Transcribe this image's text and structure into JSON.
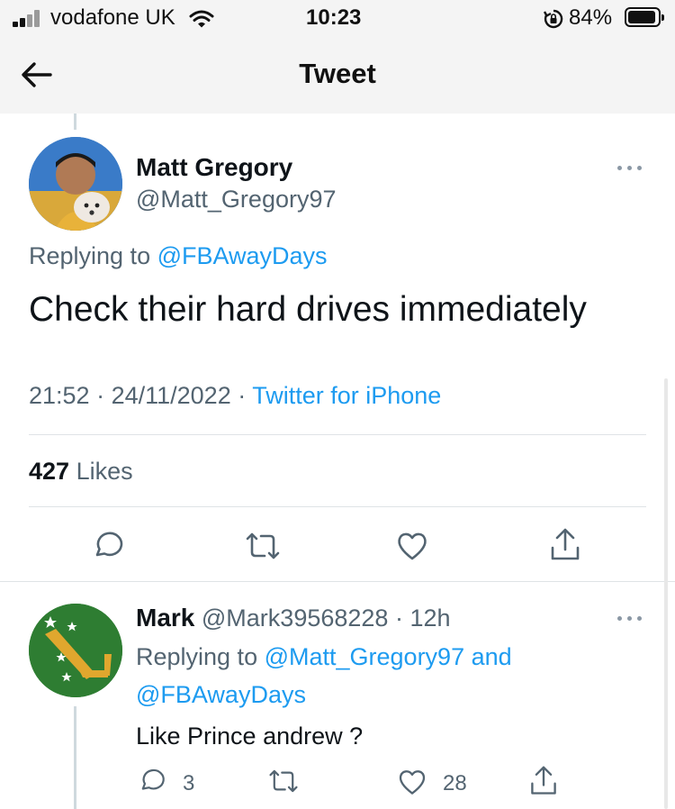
{
  "status_bar": {
    "carrier": "vodafone UK",
    "time": "10:23",
    "battery": "84%",
    "battery_level": 0.84
  },
  "nav": {
    "title": "Tweet"
  },
  "tweet": {
    "author_name": "Matt Gregory",
    "author_handle": "@Matt_Gregory97",
    "replying_prefix": "Replying to ",
    "replying_to": "@FBAwayDays",
    "text": "Check their hard drives immediately",
    "time": "21:52",
    "date": "24/11/2022",
    "source": "Twitter for iPhone",
    "likes_count": "427",
    "likes_label": "Likes"
  },
  "reply": {
    "author_name": "Mark",
    "author_handle": "@Mark39568228",
    "age": "12h",
    "replying_prefix": "Replying to ",
    "replying_to_1": "@Matt_Gregory97",
    "replying_and": " and",
    "replying_to_2": "@FBAwayDays",
    "text": "Like Prince andrew ?",
    "reply_count": "3",
    "like_count": "28"
  },
  "colors": {
    "link": "#1d9bf0",
    "muted": "#536471",
    "text": "#0f1419"
  }
}
